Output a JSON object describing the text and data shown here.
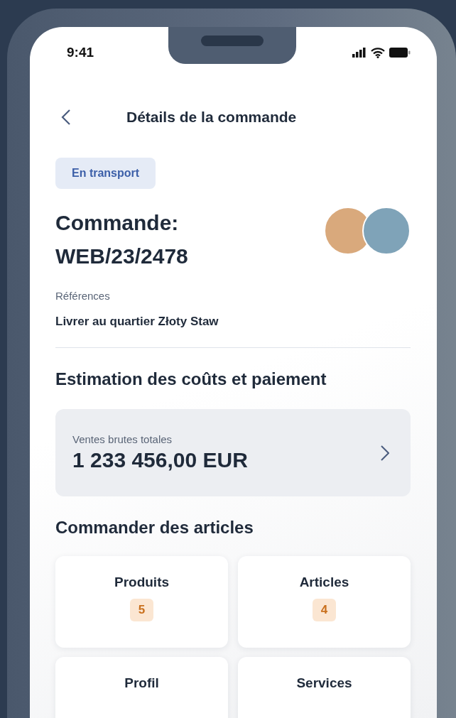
{
  "status_bar": {
    "time": "9:41"
  },
  "header": {
    "title": "Détails de la commande"
  },
  "status_badge": "En transport",
  "order": {
    "label": "Commande:",
    "number": "WEB/23/2478"
  },
  "references": {
    "label": "Références",
    "value": "Livrer au quartier Złoty Staw"
  },
  "costs": {
    "heading": "Estimation des coûts et paiement",
    "label": "Ventes brutes totales",
    "amount": "1 233 456,00 EUR"
  },
  "items": {
    "heading": "Commander des articles",
    "tiles": [
      {
        "label": "Produits",
        "count": "5"
      },
      {
        "label": "Articles",
        "count": "4"
      },
      {
        "label": "Profil"
      },
      {
        "label": "Services"
      }
    ]
  }
}
